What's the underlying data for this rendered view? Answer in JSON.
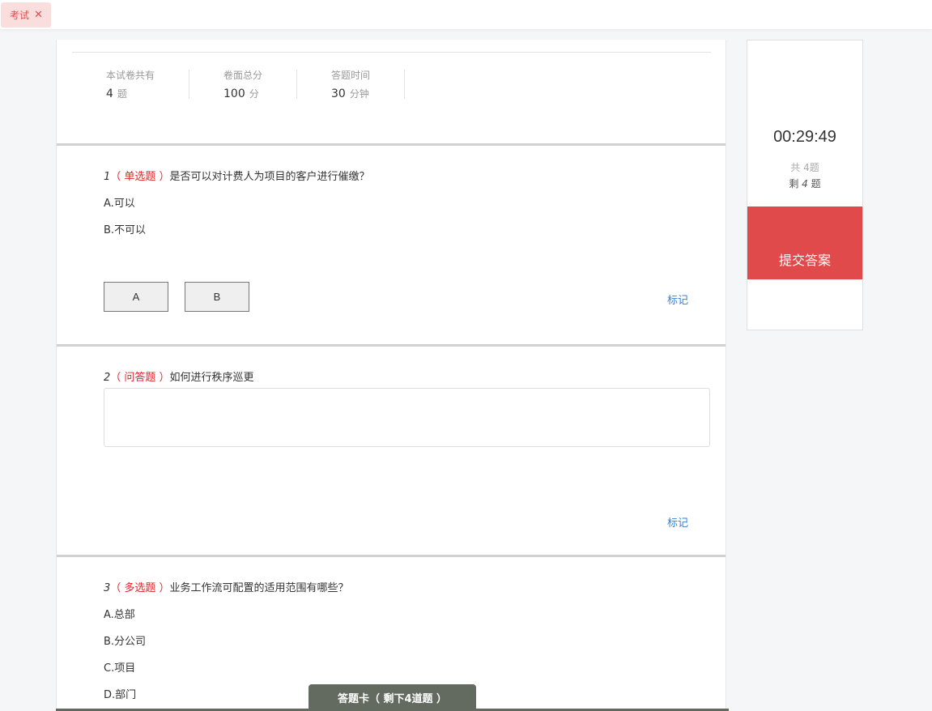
{
  "tabs": [
    {
      "label": "考试",
      "close": "✕"
    }
  ],
  "summary": {
    "question_count": {
      "label": "本试卷共有",
      "value": "4",
      "unit": "题"
    },
    "total_score": {
      "label": "卷面总分",
      "value": "100",
      "unit": "分"
    },
    "duration": {
      "label": "答题时间",
      "value": "30",
      "unit": "分钟"
    }
  },
  "questions": [
    {
      "number": "1",
      "type": "（ 单选题 ）",
      "text": "是否可以对计费人为项目的客户进行催缴？",
      "options": [
        "A.可以",
        "B.不可以"
      ],
      "answer_buttons": [
        "A",
        "B"
      ],
      "mark_label": "标记"
    },
    {
      "number": "2",
      "type": "（ 问答题 ）",
      "text": "如何进行秩序巡更",
      "answer_value": "",
      "mark_label": "标记"
    },
    {
      "number": "3",
      "type": "（ 多选题 ）",
      "text": "业务工作流可配置的适用范围有哪些？",
      "options": [
        "A.总部",
        "B.分公司",
        "C.项目",
        "D.部门"
      ]
    }
  ],
  "answer_card": {
    "label": "答题卡（ 剩下4道题 ）"
  },
  "side_panel": {
    "timer": "00:29:49",
    "total": "共 4题",
    "remaining_prefix": "剩 ",
    "remaining_value": "4",
    "remaining_suffix": " 题",
    "submit_label": "提交答案"
  },
  "colors": {
    "accent_red": "#e04a4a",
    "type_red": "#e0242a",
    "link_blue": "#3a7fd5",
    "card_bg": "#636a5f"
  }
}
